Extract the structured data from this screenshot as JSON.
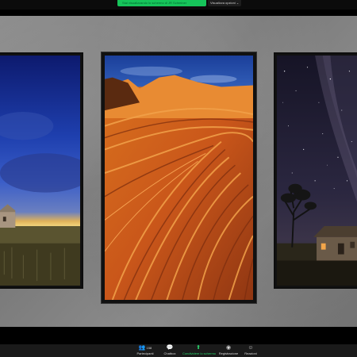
{
  "banner": {
    "share_status": "Stai visualizzando lo schermo di JR Schreiner",
    "view_options": "Visualizza opzioni ⌄"
  },
  "slides": [
    {
      "name": "sunset-farmhouse-photo"
    },
    {
      "name": "sandstone-wave-photo"
    },
    {
      "name": "night-sky-cabin-photo"
    }
  ],
  "controls": {
    "participants_label": "Partecipanti",
    "participants_count": "158",
    "chat_label": "Chatbox",
    "share_label": "Condividere lo schermo",
    "record_label": "Registrazione",
    "reactions_label": "Reazioni"
  },
  "colors": {
    "share_green": "#16c45a",
    "bar_bg": "#1a1a1a"
  }
}
